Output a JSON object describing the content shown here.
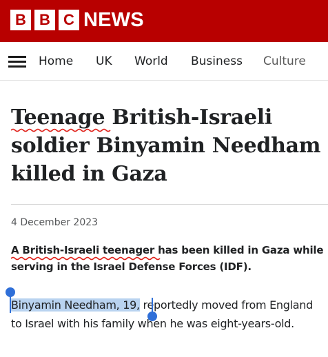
{
  "header": {
    "logo_letters": [
      "B",
      "B",
      "C"
    ],
    "logo_wordmark": "NEWS",
    "brand_color": "#b80000"
  },
  "nav": {
    "items": [
      {
        "label": "Home"
      },
      {
        "label": "UK"
      },
      {
        "label": "World"
      },
      {
        "label": "Business"
      },
      {
        "label": "Culture"
      }
    ]
  },
  "article": {
    "headline": "Teenage British-Israeli soldier Binyamin Needham killed in Gaza",
    "date": "4 December 2023",
    "intro": "A British-Israeli teenager has been killed in Gaza while serving in the Israel Defense Forces (IDF).",
    "body_selected": "Binyamin Needham, 19,",
    "body_rest": " reportedly moved from England to Israel with his family when he was eight-years-old."
  },
  "selection_color": "#2f6fd8"
}
